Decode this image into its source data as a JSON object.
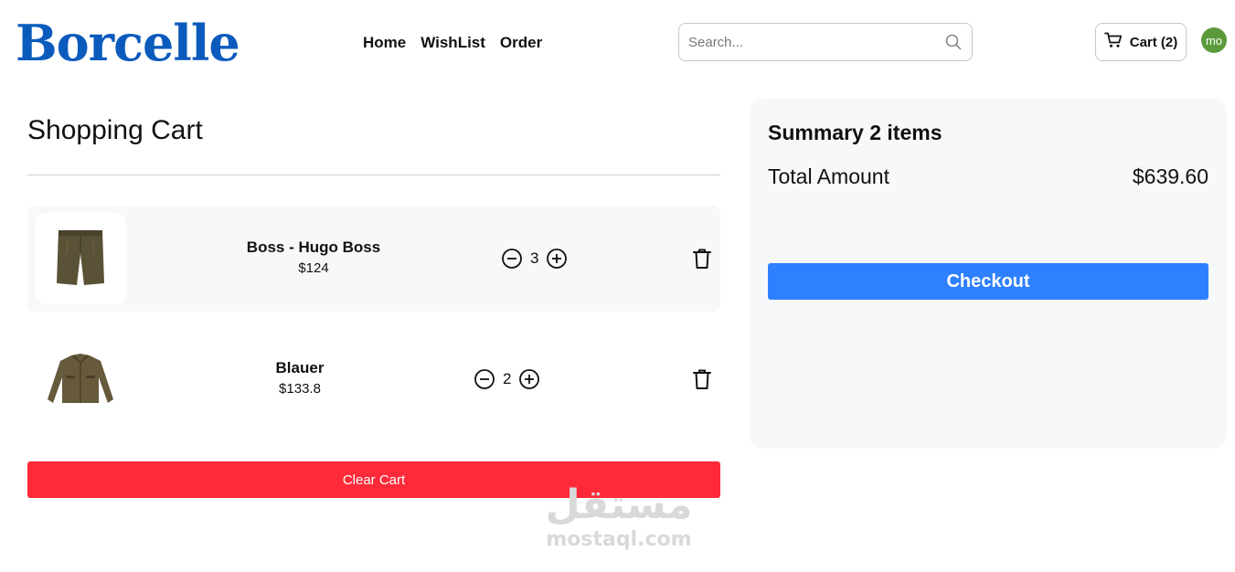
{
  "header": {
    "logo": "Borcelle",
    "nav": [
      "Home",
      "WishList",
      "Order"
    ],
    "search_placeholder": "Search...",
    "cart_label": "Cart (2)",
    "avatar_initials": "mo"
  },
  "cart": {
    "title": "Shopping Cart",
    "items": [
      {
        "name": "Boss - Hugo Boss",
        "price": "$124",
        "quantity": "3"
      },
      {
        "name": "Blauer",
        "price": "$133.8",
        "quantity": "2"
      }
    ],
    "clear_label": "Clear Cart"
  },
  "summary": {
    "title": "Summary 2 items",
    "total_label": "Total Amount",
    "total_value": "$639.60",
    "checkout_label": "Checkout"
  },
  "watermark": {
    "arabic": "مستقل",
    "latin": "mostaql.com"
  },
  "colors": {
    "brand": "#0b5bbd",
    "clear": "#fe2a39",
    "checkout": "#2f80ff",
    "avatar": "#5a9a3a"
  }
}
